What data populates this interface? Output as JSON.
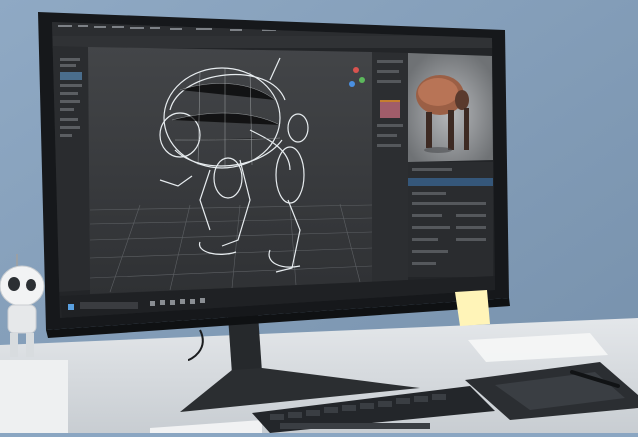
{
  "colors": {
    "wall": "#8aa6c2",
    "desk": "#d9dde1",
    "monitor_bezel": "#16181b",
    "viewport_bg": "#3b3d40",
    "ui_panel": "#2a2c2f",
    "wireframe": "#e7ecef",
    "render_copper": "#9b5f45",
    "accent": "#e18c2f",
    "sticky_note": "#fff4b8"
  },
  "icons": {
    "windows_start": "windows-start-icon",
    "search": "search-icon",
    "robot_figurine": "robot-figurine"
  },
  "scene": {
    "subject": "3d-mech-wireframe",
    "preview": "rendered-mech-copper"
  }
}
